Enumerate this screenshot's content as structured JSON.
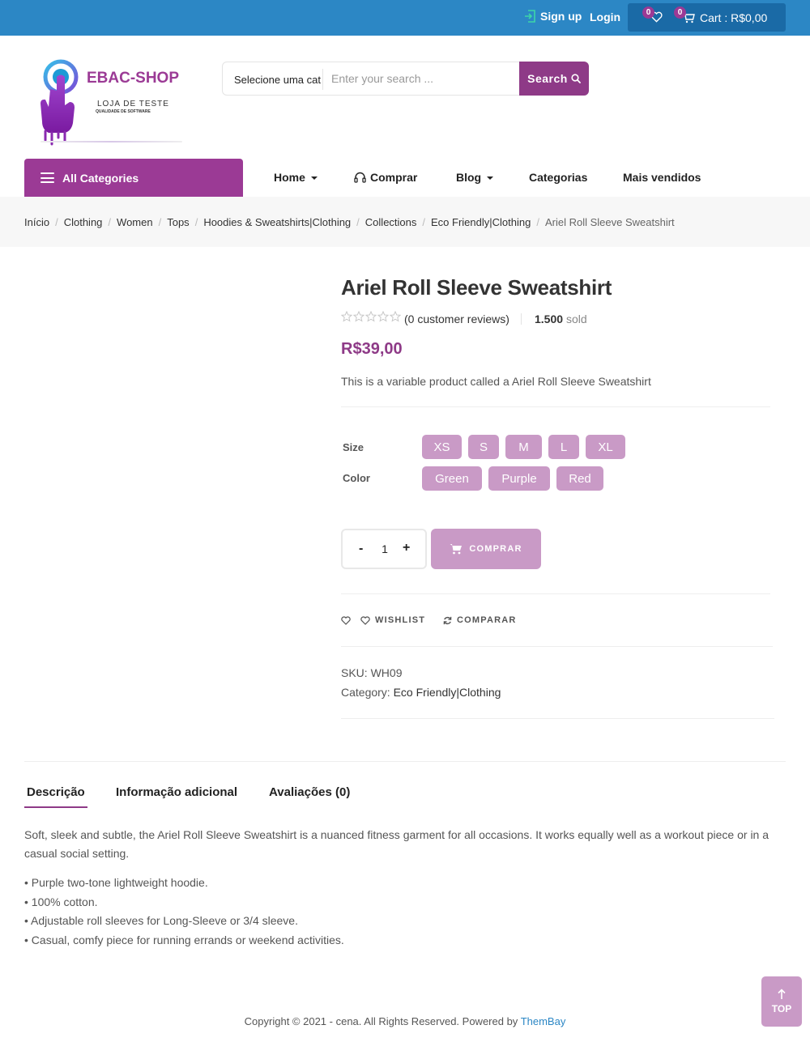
{
  "topbar": {
    "signup_label": "Sign up",
    "login_label": "Login",
    "wishlist_count": "0",
    "cart_count": "0",
    "cart_label": "Cart : R$0,00"
  },
  "header": {
    "brand": "EBAC-SHOP",
    "tagline": "LOJA DE TESTE",
    "tagline_small": "QUALIDADE DE SOFTWARE",
    "search": {
      "category": "Selecione uma cat",
      "placeholder": "Enter your search ...",
      "button_label": "Search"
    }
  },
  "nav": {
    "all_categories": "All Categories",
    "items": [
      "Home",
      "Comprar",
      "Blog",
      "Categorias",
      "Mais vendidos"
    ]
  },
  "breadcrumb": [
    "Início",
    "Clothing",
    "Women",
    "Tops",
    "Hoodies & Sweatshirts|Clothing",
    "Collections",
    "Eco Friendly|Clothing",
    "Ariel Roll Sleeve Sweatshirt"
  ],
  "product": {
    "title": "Ariel Roll Sleeve Sweatshirt",
    "rating": 0,
    "reviews_label": "(0 customer reviews)",
    "sold_count": "1.500",
    "sold_label": "sold",
    "price": "R$39,00",
    "short_description": "This is a variable product called a Ariel Roll Sleeve Sweatshirt",
    "size_label": "Size",
    "sizes": [
      "XS",
      "S",
      "M",
      "L",
      "XL"
    ],
    "color_label": "Color",
    "colors": [
      "Green",
      "Purple",
      "Red"
    ],
    "quantity": "1",
    "qty_minus": "-",
    "qty_plus": "+",
    "buy_label": "COMPRAR",
    "wishlist_label": "WISHLIST",
    "compare_label": "COMPARAR",
    "sku_label": "SKU:",
    "sku": "WH09",
    "category_label": "Category:",
    "category": "Eco Friendly|Clothing"
  },
  "tabs": {
    "items": [
      "Descrição",
      "Informação adicional",
      "Avaliações (0)"
    ],
    "active": "Descrição",
    "description": "Soft, sleek and subtle, the Ariel Roll Sleeve Sweatshirt is a nuanced fitness garment for all occasions. It works equally well as a workout piece or in a casual social setting.",
    "bullets": [
      "• Purple two-tone lightweight hoodie.",
      "• 100% cotton.",
      "• Adjustable roll sleeves for Long-Sleeve or 3/4 sleeve.",
      "• Casual, comfy piece for running errands or weekend activities."
    ]
  },
  "footer": {
    "copyright": "Copyright © 2021 - cena. All Rights Reserved. Powered by ",
    "powered_by": "ThemBay",
    "top_label": "TOP"
  },
  "colors": {
    "topbar": "#2c87c5",
    "cartbox": "#1a6aa6",
    "brand_purple": "#9b3a95",
    "swatch": "#c99ac6",
    "link_blue": "#2c87c5"
  }
}
